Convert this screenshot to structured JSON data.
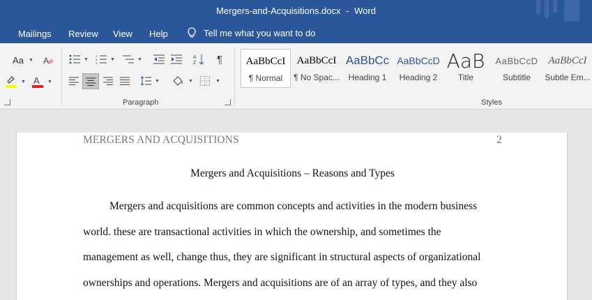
{
  "window": {
    "filename": "Mergers-and-Acquisitions.docx",
    "separator": "-",
    "app_name": "Word"
  },
  "ribbon_tabs": [
    "Mailings",
    "Review",
    "View",
    "Help"
  ],
  "tell_me": {
    "label": "Tell me what you want to do",
    "icon": "lightbulb-icon"
  },
  "groups": {
    "paragraph": "Paragraph",
    "styles": "Styles"
  },
  "font_controls": {
    "case_label": "Aa"
  },
  "styles": [
    {
      "preview": "AaBbCcI",
      "name": "¶ Normal"
    },
    {
      "preview": "AaBbCcI",
      "name": "¶ No Spac..."
    },
    {
      "preview": "AaBbCc",
      "name": "Heading 1"
    },
    {
      "preview": "AaBbCcD",
      "name": "Heading 2"
    },
    {
      "preview": "AaB",
      "name": "Title"
    },
    {
      "preview": "AaBbCcD",
      "name": "Subtitle"
    },
    {
      "preview": "AaBbCcI",
      "name": "Subtle Em..."
    }
  ],
  "colors": {
    "brand": "#2b579a",
    "highlight": "#ffff00",
    "font_color": "#e02020",
    "heading": "#2f5496"
  },
  "document": {
    "header_title": "MERGERS AND ACQUISITIONS",
    "page_number": "2",
    "title": "Mergers and Acquisitions – Reasons and Types",
    "lines": [
      "Mergers and acquisitions are common concepts and activities in the modern business",
      "world. these are transactional activities in which the ownership, and sometimes the",
      "management as well, change thus, they are significant in structural aspects of organizational",
      "ownerships and operations. Mergers and acquisitions are of an array of types, and they also"
    ]
  }
}
